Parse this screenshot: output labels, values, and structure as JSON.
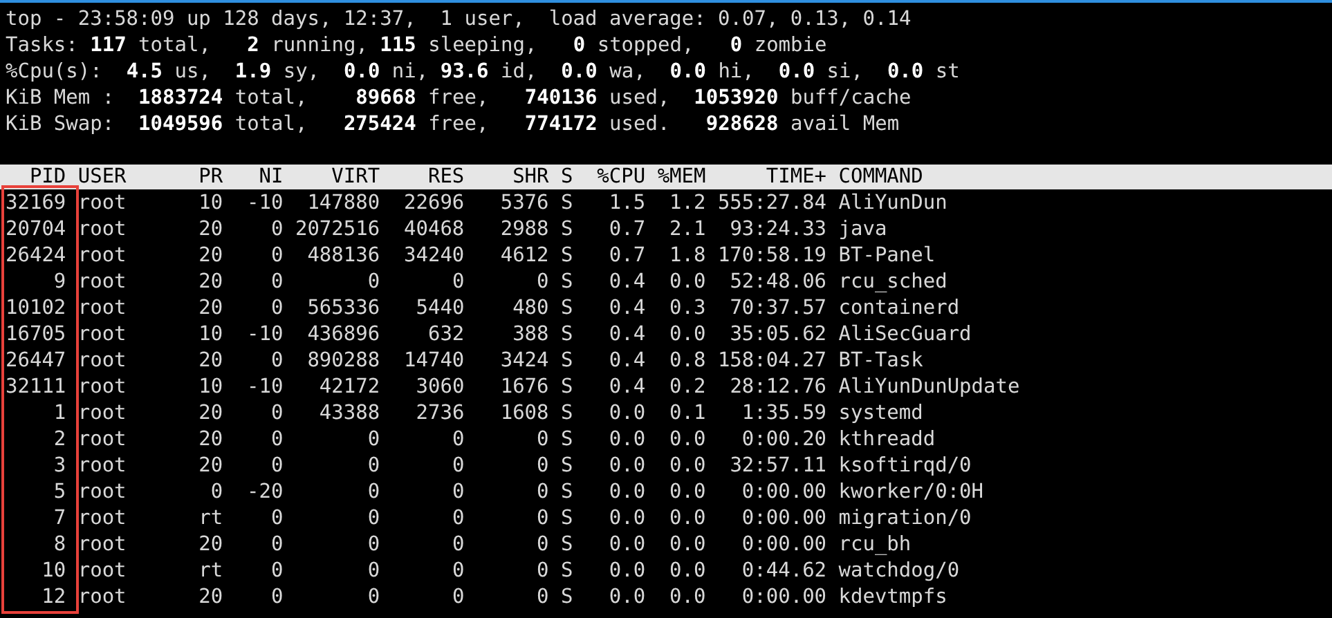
{
  "summary": [
    "top - 23:58:09 up 128 days, 12:37,  1 user,  load average: 0.07, 0.13, 0.14",
    "Tasks: **117** total,   **2** running, **115** sleeping,   **0** stopped,   **0** zombie",
    "%Cpu(s):  **4.5** us,  **1.9** sy,  **0.0** ni, **93.6** id,  **0.0** wa,  **0.0** hi,  **0.0** si,  **0.0** st",
    "KiB Mem :  **1883724** total,    **89668** free,   **740136** used,  **1053920** buff/cache",
    "KiB Swap:  **1049596** total,   **275424** free,   **774172** used.   **928628** avail Mem"
  ],
  "table": {
    "columns": [
      "PID",
      "USER",
      "PR",
      "NI",
      "VIRT",
      "RES",
      "SHR",
      "S",
      "%CPU",
      "%MEM",
      "TIME+",
      "COMMAND"
    ],
    "rows": [
      [
        "32169",
        "root",
        "10",
        "-10",
        "147880",
        "22696",
        "5376",
        "S",
        "1.5",
        "1.2",
        "555:27.84",
        "AliYunDun"
      ],
      [
        "20704",
        "root",
        "20",
        "0",
        "2072516",
        "40468",
        "2988",
        "S",
        "0.7",
        "2.1",
        "93:24.33",
        "java"
      ],
      [
        "26424",
        "root",
        "20",
        "0",
        "488136",
        "34240",
        "4612",
        "S",
        "0.7",
        "1.8",
        "170:58.19",
        "BT-Panel"
      ],
      [
        "9",
        "root",
        "20",
        "0",
        "0",
        "0",
        "0",
        "S",
        "0.4",
        "0.0",
        "52:48.06",
        "rcu_sched"
      ],
      [
        "10102",
        "root",
        "20",
        "0",
        "565336",
        "5440",
        "480",
        "S",
        "0.4",
        "0.3",
        "70:37.57",
        "containerd"
      ],
      [
        "16705",
        "root",
        "10",
        "-10",
        "436896",
        "632",
        "388",
        "S",
        "0.4",
        "0.0",
        "35:05.62",
        "AliSecGuard"
      ],
      [
        "26447",
        "root",
        "20",
        "0",
        "890288",
        "14740",
        "3424",
        "S",
        "0.4",
        "0.8",
        "158:04.27",
        "BT-Task"
      ],
      [
        "32111",
        "root",
        "10",
        "-10",
        "42172",
        "3060",
        "1676",
        "S",
        "0.4",
        "0.2",
        "28:12.76",
        "AliYunDunUpdate"
      ],
      [
        "1",
        "root",
        "20",
        "0",
        "43388",
        "2736",
        "1608",
        "S",
        "0.0",
        "0.1",
        "1:35.59",
        "systemd"
      ],
      [
        "2",
        "root",
        "20",
        "0",
        "0",
        "0",
        "0",
        "S",
        "0.0",
        "0.0",
        "0:00.20",
        "kthreadd"
      ],
      [
        "3",
        "root",
        "20",
        "0",
        "0",
        "0",
        "0",
        "S",
        "0.0",
        "0.0",
        "32:57.11",
        "ksoftirqd/0"
      ],
      [
        "5",
        "root",
        "0",
        "-20",
        "0",
        "0",
        "0",
        "S",
        "0.0",
        "0.0",
        "0:00.00",
        "kworker/0:0H"
      ],
      [
        "7",
        "root",
        "rt",
        "0",
        "0",
        "0",
        "0",
        "S",
        "0.0",
        "0.0",
        "0:00.00",
        "migration/0"
      ],
      [
        "8",
        "root",
        "20",
        "0",
        "0",
        "0",
        "0",
        "S",
        "0.0",
        "0.0",
        "0:00.00",
        "rcu_bh"
      ],
      [
        "10",
        "root",
        "rt",
        "0",
        "0",
        "0",
        "0",
        "S",
        "0.0",
        "0.0",
        "0:44.62",
        "watchdog/0"
      ],
      [
        "12",
        "root",
        "20",
        "0",
        "0",
        "0",
        "0",
        "S",
        "0.0",
        "0.0",
        "0:00.00",
        "kdevtmpfs"
      ]
    ]
  }
}
